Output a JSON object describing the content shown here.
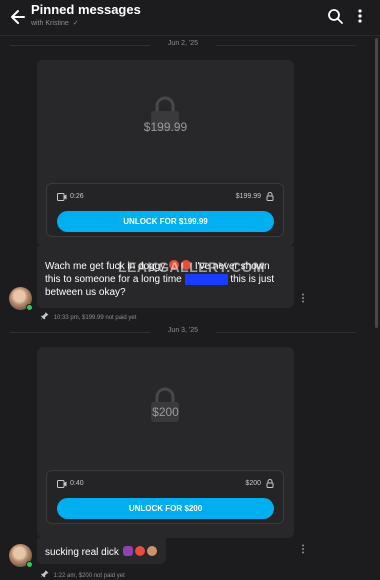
{
  "header": {
    "title": "Pinned messages",
    "subtitle": "with Kristine",
    "verified_glyph": "✓",
    "back_icon": "arrow-left-icon",
    "search_icon": "search-icon",
    "more_icon": "more-vertical-icon"
  },
  "messages": [
    {
      "date": "Jun 2, '25",
      "price_big": "$199.99",
      "duration": "0:26",
      "price_small": "$199.99",
      "unlock_label": "UNLOCK FOR $199.99",
      "text_before": "Wach me get fuck in doggy",
      "text_after": "I've never shown this to someone for a long time",
      "text_end": "this is just between us okay?",
      "time": "10:33 pm,",
      "status": "$199.99 not paid yet"
    },
    {
      "date": "Jun 3, '25",
      "price_big": "$200",
      "duration": "0:40",
      "price_small": "$200",
      "unlock_label": "UNLOCK FOR $200",
      "text": "sucking real dick",
      "time": "1:22 am,",
      "status": "$200 not paid yet"
    }
  ],
  "watermark": "LEAKGALLERY.COM",
  "colors": {
    "accent": "#00aff0",
    "background": "#1c1c1e",
    "card": "#28282a",
    "online": "#34c759"
  }
}
